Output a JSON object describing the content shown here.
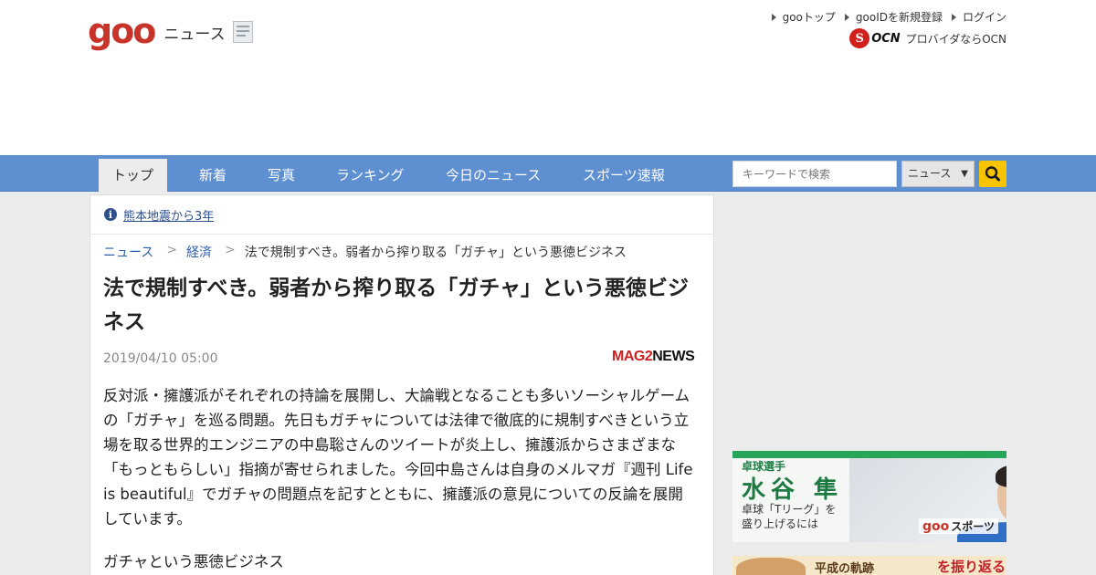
{
  "header": {
    "logo_text": "goo",
    "section_label": "ニュース",
    "links": [
      "gooトップ",
      "gooIDを新規登録",
      "ログイン"
    ],
    "ocn_logo": "OCN",
    "ocn_text": "プロバイダならOCN"
  },
  "nav": {
    "tabs": [
      "トップ",
      "新着",
      "写真",
      "ランキング",
      "今日のニュース",
      "スポーツ速報"
    ],
    "active": "トップ",
    "search_placeholder": "キーワードで検索",
    "search_scope": "ニュース"
  },
  "notice": {
    "text": "熊本地震から3年"
  },
  "breadcrumb": {
    "items": [
      "ニュース",
      "経済",
      "法で規制すべき。弱者から搾り取る「ガチャ」という悪徳ビジネス"
    ]
  },
  "article": {
    "title": "法で規制すべき。弱者から搾り取る「ガチャ」という悪徳ビジネス",
    "date": "2019/04/10 05:00",
    "source_red": "MAG2",
    "source_dark": "NEWS",
    "lead": "反対派・擁護派がそれぞれの持論を展開し、大論戦となることも多いソーシャルゲームの「ガチャ」を巡る問題。先日もガチャについては法律で徹底的に規制すべきという立場を取る世界的エンジニアの中島聡さんのツイートが炎上し、擁護派からさまざまな「もっともらしい」指摘が寄せられました。今回中島さんは自身のメルマガ『週刊 Life is beautiful』でガチャの問題点を記すとともに、擁護派の意見についての反論を展開しています。",
    "subheading": "ガチャという悪徳ビジネス"
  },
  "banners": {
    "sports": {
      "small": "卓球選手",
      "name": "水谷 隼",
      "sub1": "卓球「Tリーグ」を",
      "sub2": "盛り上げるには",
      "goo": "goo",
      "section": "スポーツ"
    },
    "heisei": {
      "text1": "平成の軌跡",
      "text2": "を振り返る"
    }
  },
  "colors": {
    "nav_bg": "#5d8fd1",
    "brand_red": "#c8342a",
    "search_button": "#f6c400"
  }
}
